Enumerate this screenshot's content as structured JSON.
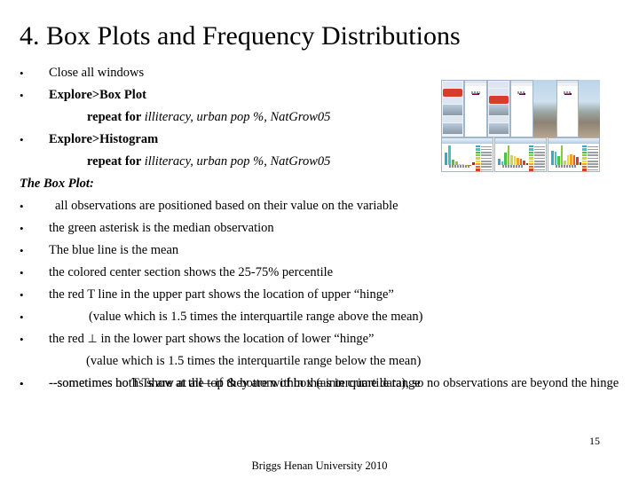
{
  "slide": {
    "title": "4. Box Plots and Frequency Distributions",
    "page_number": "15",
    "footer": "Briggs  Henan University 2010"
  },
  "instructions": [
    {
      "bullet": "•",
      "text": "Close all windows"
    },
    {
      "bullet": "•",
      "bold": "Explore>Box Plot"
    },
    {
      "sub_bold": "repeat for ",
      "sub_italic": "illiteracy, urban pop %, NatGrow05"
    },
    {
      "bullet": "•",
      "bold": "Explore>Histogram"
    },
    {
      "sub_bold": "repeat for ",
      "sub_italic": "illiteracy, urban pop %, NatGrow05"
    }
  ],
  "section": {
    "heading": "The Box Plot:"
  },
  "notes": [
    {
      "bullet": "•",
      "text": "all observations are positioned based on their value on the variable"
    },
    {
      "bullet": "•",
      "text": "the green asterisk is the median observation"
    },
    {
      "bullet": "•",
      "text": "The blue line is the mean"
    },
    {
      "bullet": "•",
      "text": "the colored center section shows the 25-75% percentile"
    },
    {
      "bullet": "•",
      "text": "the red T line in the upper part shows the location of  upper “hinge”"
    },
    {
      "bullet": "•",
      "text": "(value which is 1.5 times the interquartile range above the mean)"
    },
    {
      "bullet": "•",
      "pre": "the red ",
      "sym": "⊥",
      "post": " in the lower part shows the location of  lower “hinge”"
    },
    {
      "text": "(value which is 1.5 times the interquartile range below  the mean)"
    },
    {
      "bullet": "•",
      "text": "--sometimes both Ts are at the top & bottom of box (as in crime data), so no observations are beyond the hinge"
    },
    {
      "bullet": "•",
      "text": "--sometimes no Ts show at all—if they are within the interquartile range"
    }
  ],
  "thumbnail": {
    "name": "spss-boxplot-histogram-composite-screenshot",
    "description": "Composite screenshot of three SPSS box plot output windows above three histogram output windows on a desktop",
    "colors": {
      "box_fill": "#8e0f66",
      "median_marker": "#2bb24c",
      "mean_line": "#2d6fb5",
      "hinge_line": "#c0392b",
      "window_chrome": "#bcd3ea"
    },
    "boxplots": [
      {
        "label": "illiteracy"
      },
      {
        "label": "urban pop %"
      },
      {
        "label": "NatGrow05"
      }
    ],
    "histograms": [
      {
        "label": "illiteracy",
        "bars": [
          62,
          100,
          26,
          16,
          5,
          3,
          2,
          1,
          14
        ],
        "bar_colors": [
          "#3aa8c1",
          "#45c3b8",
          "#4cc04a",
          "#8fc63d",
          "#c8d948",
          "#f2d73c",
          "#f0a22e",
          "#e2622a",
          "#9c2b1b"
        ]
      },
      {
        "label": "urban pop %",
        "bars": [
          30,
          18,
          62,
          100,
          48,
          44,
          36,
          30,
          22,
          10
        ],
        "bar_colors": [
          "#3aa8c1",
          "#45c3b8",
          "#4cc04a",
          "#8fc63d",
          "#c8d948",
          "#f2d73c",
          "#f0a22e",
          "#e2622a",
          "#d2402a",
          "#9c2b1b"
        ]
      },
      {
        "label": "NatGrow05",
        "bars": [
          72,
          66,
          44,
          100,
          24,
          52,
          56,
          50,
          40,
          12
        ],
        "bar_colors": [
          "#3aa8c1",
          "#45c3b8",
          "#4cc04a",
          "#8fc63d",
          "#c8d948",
          "#f2d73c",
          "#f0a22e",
          "#e2622a",
          "#d2402a",
          "#9c2b1b"
        ]
      }
    ],
    "legend_colors": [
      "#3aa8c1",
      "#45c3b8",
      "#4cc04a",
      "#8fc63d",
      "#c8d948",
      "#f2d73c",
      "#f0a22e",
      "#e2622a",
      "#d2402a",
      "#9c2b1b"
    ]
  }
}
